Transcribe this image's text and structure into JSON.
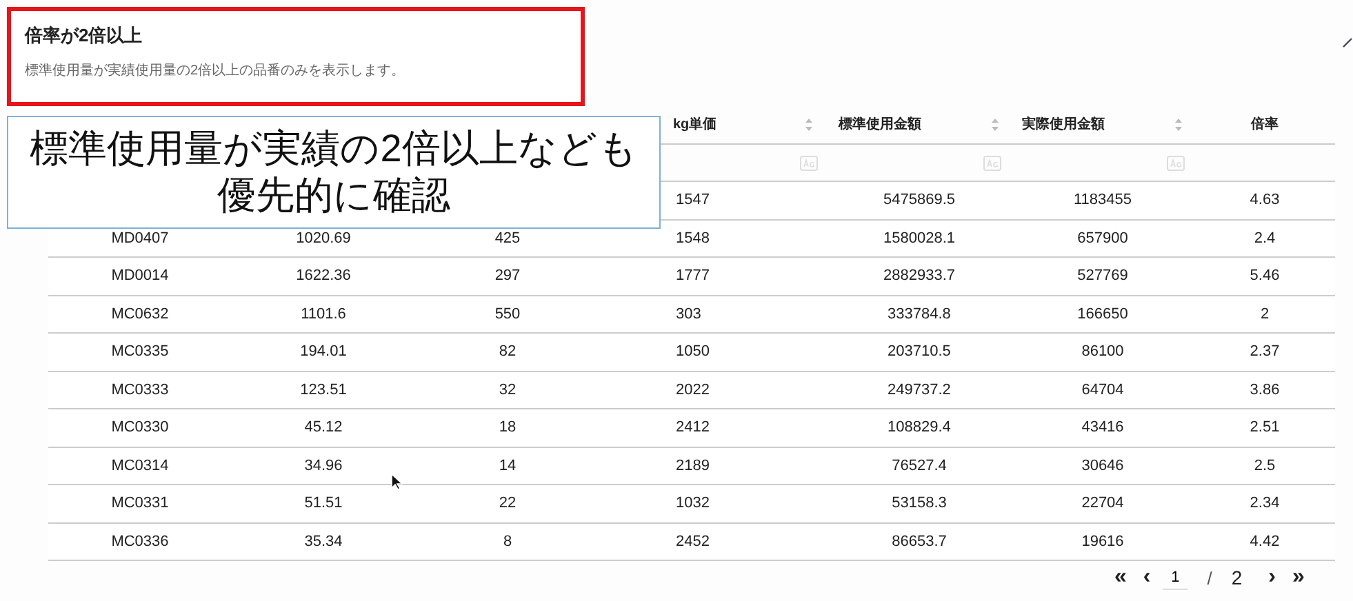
{
  "card": {
    "title": "倍率が2倍以上",
    "description": "標準使用量が実績使用量の2倍以上の品番のみを表示します。"
  },
  "callout": {
    "lines": [
      "標準使用量が実績の2倍以上なども",
      "優先的に確認"
    ]
  },
  "table": {
    "columns": [
      null,
      null,
      null,
      {
        "label": "kg単価",
        "sortable": true,
        "filter": true
      },
      {
        "label": "標準使用金額",
        "sortable": true,
        "filter": true
      },
      {
        "label": "実際使用金額",
        "sortable": true,
        "filter": true
      },
      {
        "label": "倍率",
        "sortable": false,
        "filter": false
      }
    ],
    "rows": [
      [
        null,
        null,
        null,
        "1547",
        "5475869.5",
        "1183455",
        "4.63"
      ],
      [
        "MD0407",
        "1020.69",
        "425",
        "1548",
        "1580028.1",
        "657900",
        "2.4"
      ],
      [
        "MD0014",
        "1622.36",
        "297",
        "1777",
        "2882933.7",
        "527769",
        "5.46"
      ],
      [
        "MC0632",
        "1101.6",
        "550",
        "303",
        "333784.8",
        "166650",
        "2"
      ],
      [
        "MC0335",
        "194.01",
        "82",
        "1050",
        "203710.5",
        "86100",
        "2.37"
      ],
      [
        "MC0333",
        "123.51",
        "32",
        "2022",
        "249737.2",
        "64704",
        "3.86"
      ],
      [
        "MC0330",
        "45.12",
        "18",
        "2412",
        "108829.4",
        "43416",
        "2.51"
      ],
      [
        "MC0314",
        "34.96",
        "14",
        "2189",
        "76527.4",
        "30646",
        "2.5"
      ],
      [
        "MC0331",
        "51.51",
        "22",
        "1032",
        "53158.3",
        "22704",
        "2.34"
      ],
      [
        "MC0336",
        "35.34",
        "8",
        "2452",
        "86653.7",
        "19616",
        "4.42"
      ]
    ]
  },
  "pagination": {
    "first": "«",
    "prev": "‹",
    "page": "1",
    "separator": "/",
    "total": "2",
    "next": "›",
    "last": "»"
  }
}
